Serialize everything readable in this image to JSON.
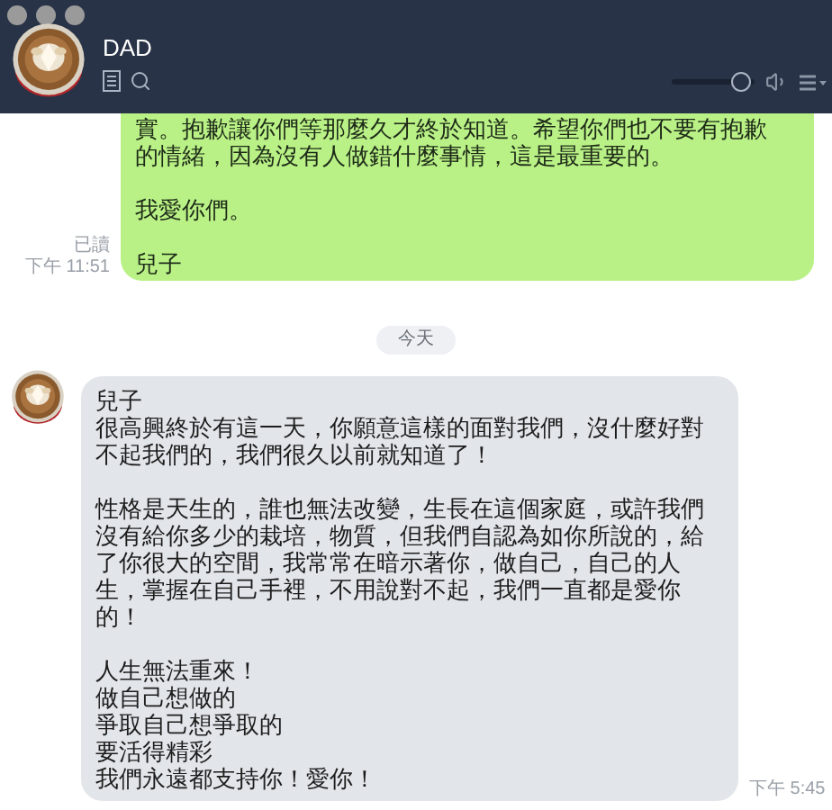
{
  "header": {
    "title": "DAD",
    "volume": {
      "level": 0.95
    }
  },
  "messages": [
    {
      "kind": "sent",
      "read_receipt": "已讀",
      "time": "下午 11:51",
      "paragraphs": [
        [
          "實。抱歉讓你們等那麼久才終於知道。希望你們也不要有抱歉的情緒，因為沒有人做錯什麼事情，這是最重要的。"
        ],
        [
          "我愛你們。"
        ],
        [
          "兒子"
        ]
      ]
    },
    {
      "kind": "date",
      "label": "今天"
    },
    {
      "kind": "received",
      "time": "下午 5:45",
      "paragraphs": [
        [
          "兒子",
          "很高興終於有這一天，你願意這樣的面對我們，沒什麼好對不起我們的，我們很久以前就知道了！"
        ],
        [
          "性格是天生的，誰也無法改變，生長在這個家庭，或許我們沒有給你多少的栽培，物質，但我們自認為如你所說的，給了你很大的空間，我常常在暗示著你，做自己，自己的人生，掌握在自己手裡，不用說對不起，我們一直都是愛你的！"
        ],
        [
          "人生無法重來！",
          "做自己想做的",
          "爭取自己想爭取的",
          "要活得精彩",
          "我們永遠都支持你！愛你！"
        ]
      ]
    }
  ]
}
